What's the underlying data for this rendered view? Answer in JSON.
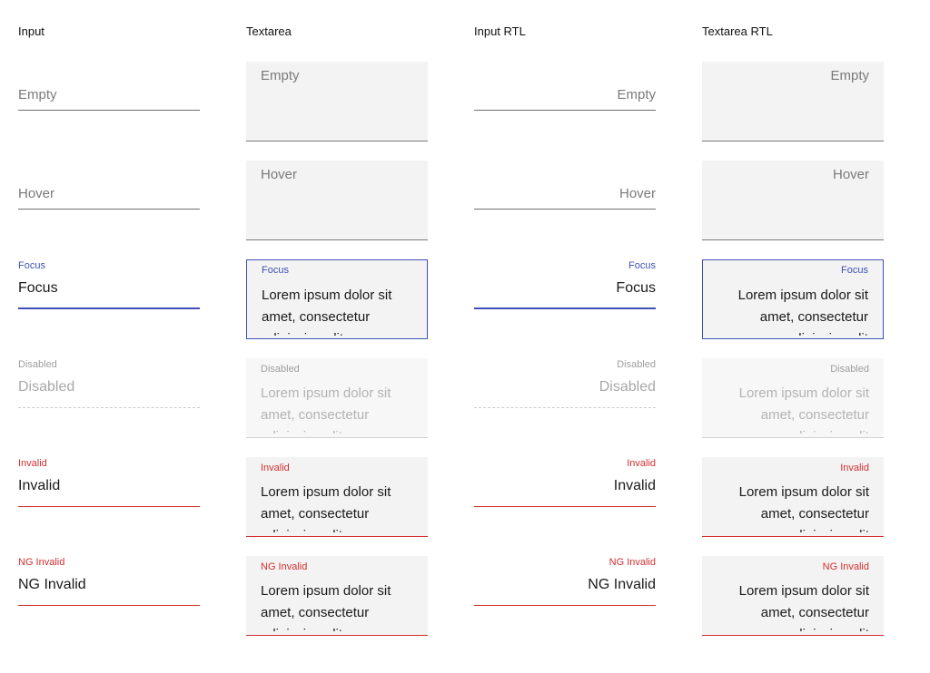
{
  "columns": {
    "input": {
      "title": "Input"
    },
    "textarea": {
      "title": "Textarea"
    },
    "input_rtl": {
      "title": "Input RTL"
    },
    "textarea_rtl": {
      "title": "Textarea RTL"
    }
  },
  "fields": {
    "empty": {
      "placeholder": "Empty"
    },
    "hover": {
      "placeholder": "Hover"
    },
    "focus": {
      "label": "Focus",
      "value": "Focus"
    },
    "disabled": {
      "label": "Disabled",
      "value": "Disabled"
    },
    "invalid": {
      "label": "Invalid",
      "value": "Invalid"
    },
    "ng_invalid": {
      "label": "NG Invalid",
      "value": "NG Invalid"
    }
  },
  "textarea_value": "Lorem ipsum dolor sit amet, consectetur adipiscing elit",
  "colors": {
    "focus": "#3f51b5",
    "invalid": "#d32f2f",
    "textarea_bg": "#f3f3f3"
  }
}
